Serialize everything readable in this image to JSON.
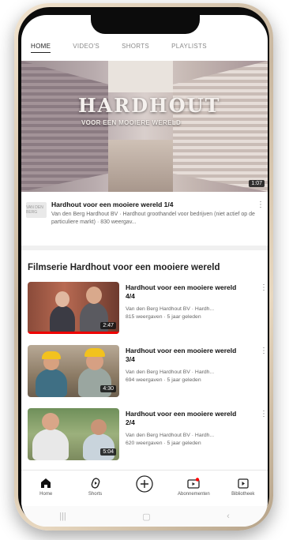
{
  "tabs": [
    "HOME",
    "VIDEO'S",
    "SHORTS",
    "PLAYLISTS"
  ],
  "featured": {
    "overlay_title": "HARDHOUT",
    "overlay_subtitle": "VOOR EEN MOOIERE WERELD",
    "duration": "1:07",
    "channel_logo_text": "VAN DEN BERG",
    "title": "Hardhout voor een mooiere wereld 1/4",
    "meta": "Van den Berg Hardhout BV · Hardhout groothandel voor bedrijven (niet actief op de particuliere markt) · 830 weergav..."
  },
  "section": {
    "title": "Filmserie Hardhout voor een mooiere wereld"
  },
  "videos": [
    {
      "title": "Hardhout voor een mooiere wereld 4/4",
      "channel": "Van den Berg Hardhout BV · Hardh...",
      "stats": "815 weergaven · 5 jaar geleden",
      "duration": "2:47",
      "watched": 1.0
    },
    {
      "title": "Hardhout voor een mooiere wereld 3/4",
      "channel": "Van den Berg Hardhout BV · Hardh...",
      "stats": "694 weergaven · 5 jaar geleden",
      "duration": "4:30",
      "watched": 0
    },
    {
      "title": "Hardhout voor een mooiere wereld 2/4",
      "channel": "Van den Berg Hardhout BV · Hardh...",
      "stats": "620 weergaven · 5 jaar geleden",
      "duration": "5:04",
      "watched": 0
    }
  ],
  "bottom_nav": [
    {
      "label": "Home",
      "icon": "home-icon"
    },
    {
      "label": "Shorts",
      "icon": "shorts-icon"
    },
    {
      "label": "",
      "icon": "add-icon"
    },
    {
      "label": "Abonnementen",
      "icon": "subscriptions-icon"
    },
    {
      "label": "Bibliotheek",
      "icon": "library-icon"
    }
  ],
  "colors": {
    "accent": "#ff0000",
    "text": "#111111",
    "muted": "#666666"
  }
}
